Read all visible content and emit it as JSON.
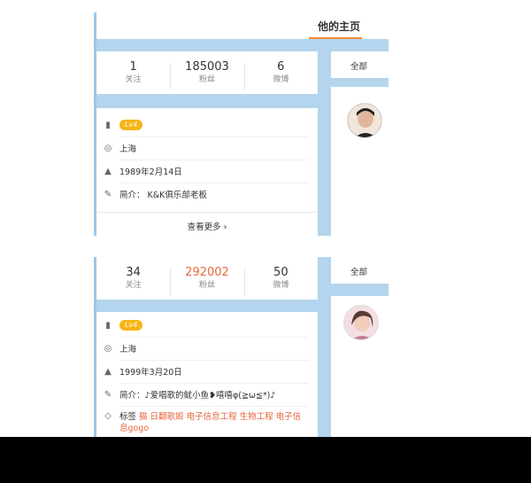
{
  "profile1": {
    "header": {
      "tab_home": "他的主页"
    },
    "stats": [
      {
        "num": "1",
        "label": "关注"
      },
      {
        "num": "185003",
        "label": "粉丝"
      },
      {
        "num": "6",
        "label": "微博"
      }
    ],
    "level": "Lv4",
    "location": "上海",
    "birthday": "1989年2月14日",
    "bio": "简介： K&K俱乐部老板",
    "see_more": "查看更多 ›",
    "filter_all": "全部"
  },
  "profile2": {
    "stats": [
      {
        "num": "34",
        "label": "关注"
      },
      {
        "num": "292002",
        "label": "粉丝"
      },
      {
        "num": "50",
        "label": "微博"
      }
    ],
    "level": "Lv4",
    "location": "上海",
    "birthday": "1999年3月20日",
    "bio": "简介：♪爱唱歌的鱿小鱼❥嘻嘻φ(≧ω≦*)♪",
    "tags_label": "标签",
    "tags": "猫 日翻歌姬 电子信息工程 生物工程 电子信息gogo",
    "filter_all": "全部"
  },
  "colors": {
    "accent": "#f28b31",
    "fans_highlight": "#e8663d",
    "panel_bg": "#b4d5ed",
    "level_badge": "#f7b515"
  },
  "icons": [
    "bookmark-icon",
    "location-icon",
    "cake-icon",
    "edit-icon",
    "tag-icon",
    "chevron-right-icon"
  ]
}
